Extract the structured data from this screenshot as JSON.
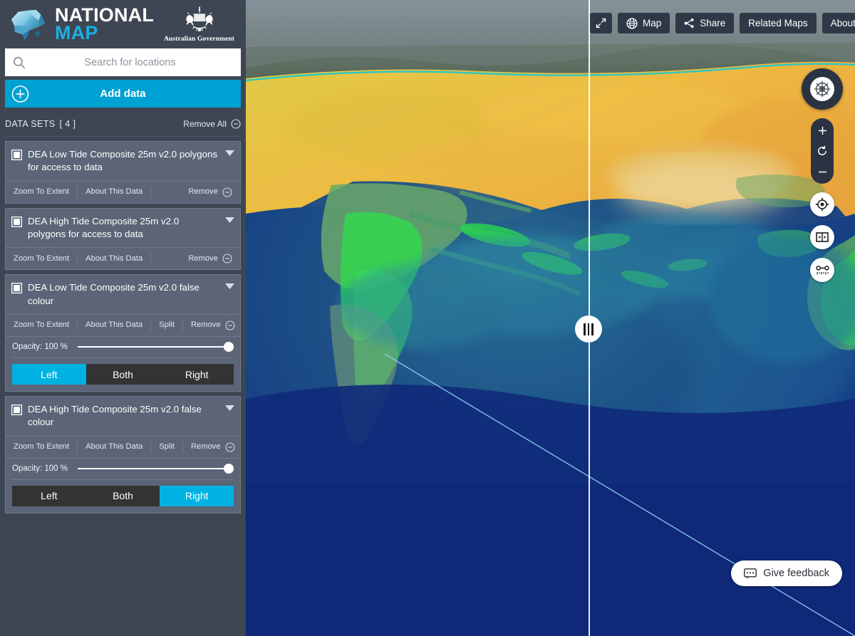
{
  "brand": {
    "line1": "NATIONAL",
    "line2": "MAP",
    "govt_text": "Australian Government",
    "logo_icon": "australia-map-logo",
    "crest_icon": "commonwealth-coat-of-arms"
  },
  "search": {
    "placeholder": "Search for locations",
    "value": "",
    "icon": "search-icon"
  },
  "add_data": {
    "label": "Add data",
    "icon": "plus-circle-icon"
  },
  "datasets_panel": {
    "title": "DATA SETS",
    "count": "[ 4 ]",
    "remove_all": "Remove All",
    "remove_all_icon": "circle-minus-icon"
  },
  "actions": {
    "zoom_to_extent": "Zoom To Extent",
    "about_this_data": "About This Data",
    "split": "Split",
    "remove": "Remove",
    "remove_icon": "circle-minus-icon",
    "caret_icon": "chevron-down-icon",
    "checkbox_icon": "checkbox-square-icon"
  },
  "datasets": [
    {
      "name": "DEA Low Tide Composite 25m v2.0 polygons for access to data",
      "has_split": false,
      "has_opacity": false
    },
    {
      "name": "DEA High Tide Composite 25m v2.0 polygons for access to data",
      "has_split": false,
      "has_opacity": false
    },
    {
      "name": "DEA Low Tide Composite 25m v2.0 false colour",
      "has_split": true,
      "has_opacity": true,
      "opacity_label": "Opacity: 100 %",
      "opacity_value": 100,
      "split_options": [
        "Left",
        "Both",
        "Right"
      ],
      "split_selected": "Left"
    },
    {
      "name": "DEA High Tide Composite 25m v2.0 false colour",
      "has_split": true,
      "has_opacity": true,
      "opacity_label": "Opacity: 100 %",
      "opacity_value": 100,
      "split_options": [
        "Left",
        "Both",
        "Right"
      ],
      "split_selected": "Right"
    }
  ],
  "map_toolbar": {
    "fullscreen_icon": "expand-arrows-icon",
    "map_label": "Map",
    "map_icon": "globe-icon",
    "share_label": "Share",
    "share_icon": "share-nodes-icon",
    "related_maps_label": "Related Maps",
    "about_label": "About"
  },
  "map_controls": {
    "compass_icon": "compass-gyroscope-icon",
    "zoom_in_icon": "plus-icon",
    "reset_icon": "refresh-icon",
    "zoom_out_icon": "minus-icon",
    "locate_icon": "crosshair-target-icon",
    "split_screen_icon": "split-screen-icon",
    "measure_icon": "measure-tool-icon"
  },
  "feedback": {
    "label": "Give feedback",
    "icon": "speech-bubble-icon"
  },
  "split_handle": {
    "icon": "drag-grip-icon"
  },
  "colors": {
    "accent": "#00a2d4",
    "accent_bright": "#00b2e2",
    "sidebar_bg": "#3e4654",
    "panel_bg": "#5b6577",
    "toolbar_bg": "#2f3847"
  }
}
